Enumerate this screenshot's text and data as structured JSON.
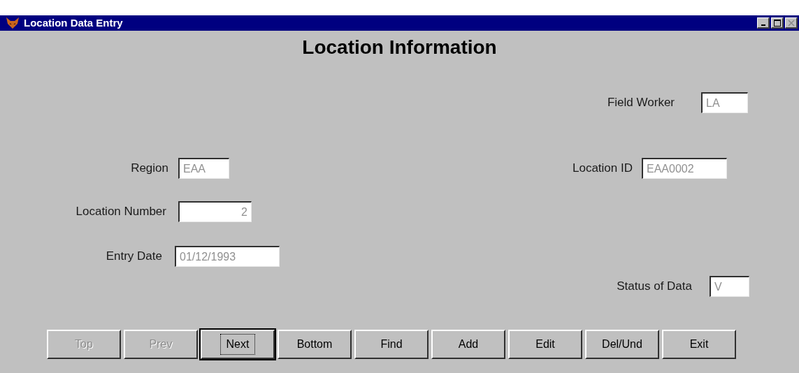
{
  "window": {
    "title": "Location Data Entry",
    "controls": [
      {
        "kind": "minimize",
        "disabled": false
      },
      {
        "kind": "maximize",
        "disabled": false
      },
      {
        "kind": "close",
        "disabled": true
      }
    ]
  },
  "heading": "Location Information",
  "fields": [
    {
      "label": "Field Worker",
      "value": "LA"
    },
    {
      "label": "Region",
      "value": "EAA"
    },
    {
      "label": "Location ID",
      "value": "EAA0002"
    },
    {
      "label": "Location Number",
      "value": "2"
    },
    {
      "label": "Entry Date",
      "value": "01/12/1993"
    },
    {
      "label": "Status of Data",
      "value": "V"
    }
  ],
  "buttons": [
    {
      "label": "Top",
      "disabled": true,
      "default": false
    },
    {
      "label": "Prev",
      "disabled": true,
      "default": false
    },
    {
      "label": "Next",
      "disabled": false,
      "default": true
    },
    {
      "label": "Bottom",
      "disabled": false,
      "default": false
    },
    {
      "label": "Find",
      "disabled": false,
      "default": false
    },
    {
      "label": "Add",
      "disabled": false,
      "default": false
    },
    {
      "label": "Edit",
      "disabled": false,
      "default": false
    },
    {
      "label": "Del/Und",
      "disabled": false,
      "default": false
    },
    {
      "label": "Exit",
      "disabled": false,
      "default": false
    }
  ]
}
